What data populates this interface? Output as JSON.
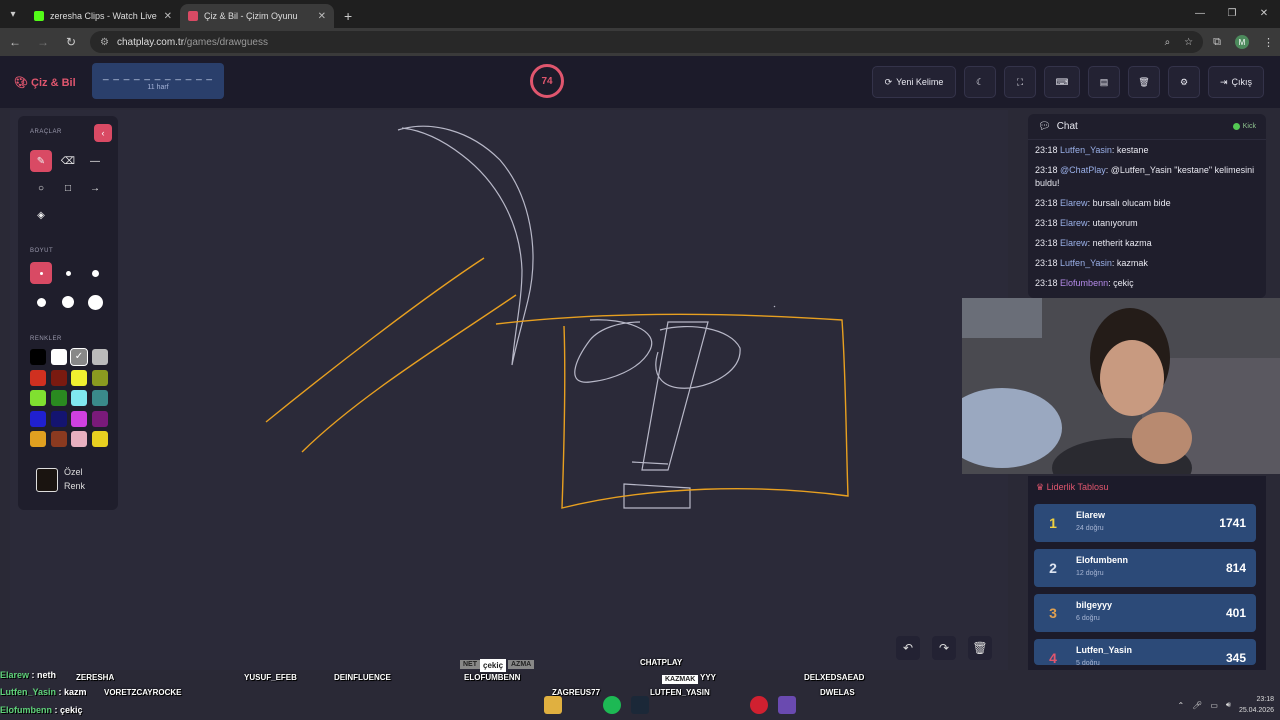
{
  "browser": {
    "tabs": [
      {
        "title": "zeresha Clips - Watch Live on K",
        "favicon_color": "#53fc18"
      },
      {
        "title": "Çiz & Bil - Çizim Oyunu",
        "favicon_color": "#d94a64"
      }
    ],
    "url_host": "chatplay.com.tr",
    "url_path": "/games/drawguess",
    "profile_initial": "M"
  },
  "header": {
    "logo": "Çiz & Bil",
    "word_dashes": "_ _ _ _ _ _ _ _ _ _ _",
    "word_hint": "11 harf",
    "timer": "74",
    "new_word_label": "Yeni Kelime",
    "exit_label": "Çıkış"
  },
  "tools": {
    "tools_title": "ARAÇLAR",
    "size_title": "BOYUT",
    "colors_title": "RENKLER",
    "custom_color_line1": "Özel",
    "custom_color_line2": "Renk",
    "colors": [
      "#000000",
      "#ffffff",
      "#888888",
      "#bbbbbb",
      "#d03020",
      "#7a1a10",
      "#f0f030",
      "#8a9a20",
      "#80e030",
      "#2a8a20",
      "#80e8f0",
      "#3a8a8a",
      "#2020d0",
      "#141470",
      "#d040e0",
      "#7a1a7a",
      "#e0a020",
      "#8a3a20",
      "#e8b0c0",
      "#e8d020"
    ]
  },
  "chat": {
    "title": "Chat",
    "platform": "Kick",
    "messages": [
      {
        "time": "23:18",
        "user": "Lutfen_Yasin",
        "text": ": kestane",
        "style": "u"
      },
      {
        "time": "23:18",
        "user": "@ChatPlay",
        "text": ": @Lutfen_Yasin \"kestane\" kelimesini buldu!",
        "style": "u"
      },
      {
        "time": "23:18",
        "user": "Elarew",
        "text": ": bursalı olucam bide",
        "style": "u"
      },
      {
        "time": "23:18",
        "user": "Elarew",
        "text": ": utanıyorum",
        "style": "u"
      },
      {
        "time": "23:18",
        "user": "Elarew",
        "text": ": netherit kazma",
        "style": "u"
      },
      {
        "time": "23:18",
        "user": "Lutfen_Yasin",
        "text": ": kazmak",
        "style": "u"
      },
      {
        "time": "23:18",
        "user": "Elofumbenn",
        "text": ": çekiç",
        "style": "u2"
      }
    ]
  },
  "leaderboard": {
    "title": "Liderlik Tablosu",
    "rows": [
      {
        "rank": "1",
        "name": "Elarew",
        "sub": "24 doğru",
        "score": "1741",
        "rank_color": "#f0d040"
      },
      {
        "rank": "2",
        "name": "Elofumbenn",
        "sub": "12 doğru",
        "score": "814",
        "rank_color": "#dde4f0"
      },
      {
        "rank": "3",
        "name": "bilgeyyy",
        "sub": "6 doğru",
        "score": "401",
        "rank_color": "#e0a050"
      },
      {
        "rank": "4",
        "name": "Lutfen_Yasin",
        "sub": "5 doğru",
        "score": "345",
        "rank_color": "#e0566e"
      }
    ]
  },
  "overlay": {
    "chat_lines": [
      {
        "name": "Elarew",
        "text": " : neth"
      },
      {
        "name": "Lutfen_Yasin",
        "text": " : kazm"
      },
      {
        "name": "Elofumbenn",
        "text": " : çekiç"
      }
    ],
    "names": [
      "ZERESHA",
      "VORETZCAYROCKE",
      "YUSUF_EFEB",
      "DEINFLUENCE",
      "ELOFUMBENN",
      "ZAGREUS77",
      "CHATPLAY",
      "LUTFEN_YASIN",
      "YYY",
      "DELXEDSAEAD",
      "DWELAS"
    ],
    "bubble1": "NET",
    "bubble2": "çekiç",
    "bubble3": "AZMA",
    "bubble4": "KAZMAK"
  },
  "taskbar": {
    "time": "23:18",
    "date": "25.04.2026"
  },
  "colors": {
    "accent": "#d94a64",
    "panel": "#1f1e2c",
    "canvas": "#2b2a39",
    "stroke_orange": "#e8a020",
    "stroke_grey": "#b8b8c8"
  }
}
